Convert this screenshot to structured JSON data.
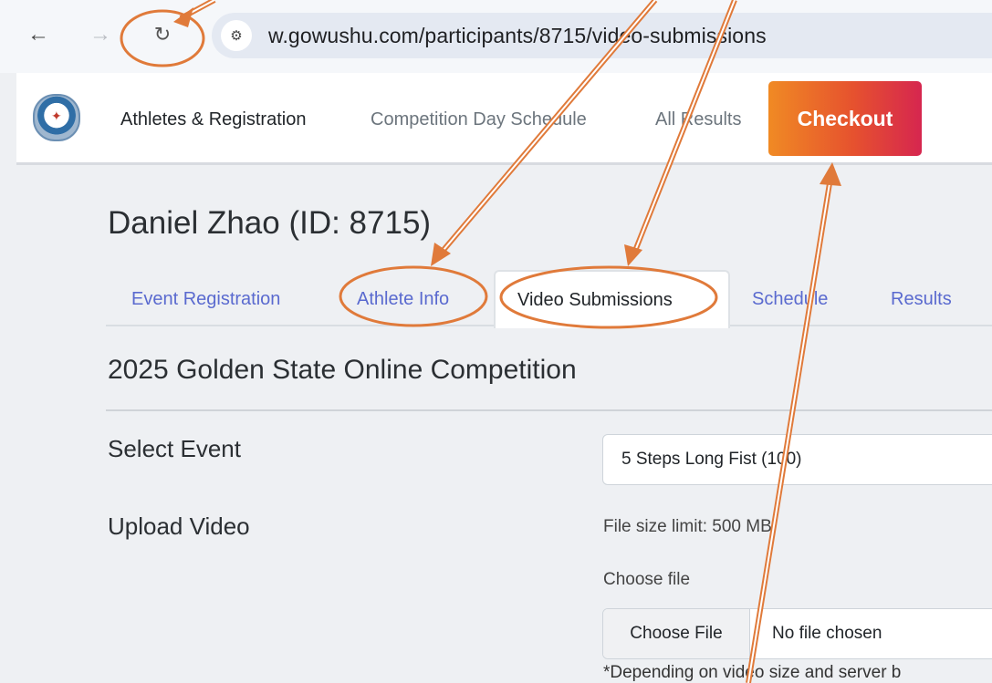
{
  "browser": {
    "back_icon": "arrow-left-icon",
    "forward_icon": "arrow-right-icon",
    "reload_icon": "reload-icon",
    "site_settings_icon": "tune-icon",
    "url": "w.gowushu.com/participants/8715/video-submissions"
  },
  "header": {
    "logo_icon": "organization-seal-icon",
    "nav": [
      "Athletes & Registration",
      "Competition Day Schedule",
      "All Results"
    ],
    "checkout_label": "Checkout"
  },
  "page": {
    "title": "Daniel Zhao (ID: 8715)",
    "tabs": [
      "Event Registration",
      "Athlete Info",
      "Video Submissions",
      "Schedule",
      "Results"
    ],
    "active_tab": "Video Submissions",
    "section_title": "2025 Golden State Online Competition"
  },
  "form": {
    "select_event_label": "Select Event",
    "select_event_value": "5 Steps Long Fist (100)",
    "upload_video_label": "Upload Video",
    "file_size_limit": "File size limit: 500 MB",
    "choose_file_label": "Choose file",
    "choose_file_button": "Choose File",
    "no_file_chosen": "No file chosen",
    "note": "*Depending on video size and server b"
  },
  "colors": {
    "annotation": "#e07a3a",
    "checkout_start": "#f08a24",
    "checkout_end": "#d6264f",
    "tab_link": "#5a6acf"
  }
}
